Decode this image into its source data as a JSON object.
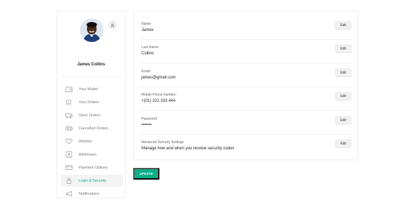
{
  "profile": {
    "name": "James Collins"
  },
  "sidebar": {
    "items": [
      {
        "label": "Your Wallet",
        "icon": "wallet-icon"
      },
      {
        "label": "Your Orders",
        "icon": "orders-icon"
      },
      {
        "label": "Open Orders",
        "icon": "open-orders-icon"
      },
      {
        "label": "Cancelled Orders",
        "icon": "cancelled-orders-icon"
      },
      {
        "label": "Wishlist",
        "icon": "heart-icon"
      },
      {
        "label": "Addresses",
        "icon": "address-book-icon"
      },
      {
        "label": "Payment Options",
        "icon": "payment-icon"
      },
      {
        "label": "Login & Security",
        "icon": "lock-icon",
        "active": true
      },
      {
        "label": "Notifications",
        "icon": "megaphone-icon"
      }
    ]
  },
  "fields": [
    {
      "label": "Name:",
      "value": "James",
      "edit": "Edit"
    },
    {
      "label": "Last Name:",
      "value": "Collins",
      "edit": "Edit"
    },
    {
      "label": "Email:",
      "value": "james@gmail.com",
      "edit": "Edit"
    },
    {
      "label": "Mobile Phone Number:",
      "value": "+(01) 222 333 444",
      "edit": "Edit"
    },
    {
      "label": "Password:",
      "value": "•••••••",
      "edit": "Edit"
    },
    {
      "label": "Advanced Security Settings",
      "value": "Manage how and when you receive security codes",
      "edit": "Edit"
    }
  ],
  "actions": {
    "update_label": "UPDATE"
  },
  "colors": {
    "accent": "#0bb08a",
    "border": "#eeeeee",
    "active_bg": "#f3f3f3"
  }
}
